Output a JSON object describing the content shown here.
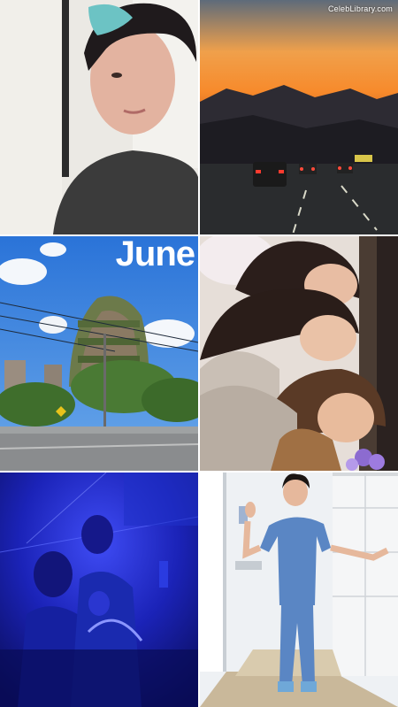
{
  "watermark": "CelebLibrary.com",
  "tiles": {
    "june_label": "June"
  }
}
